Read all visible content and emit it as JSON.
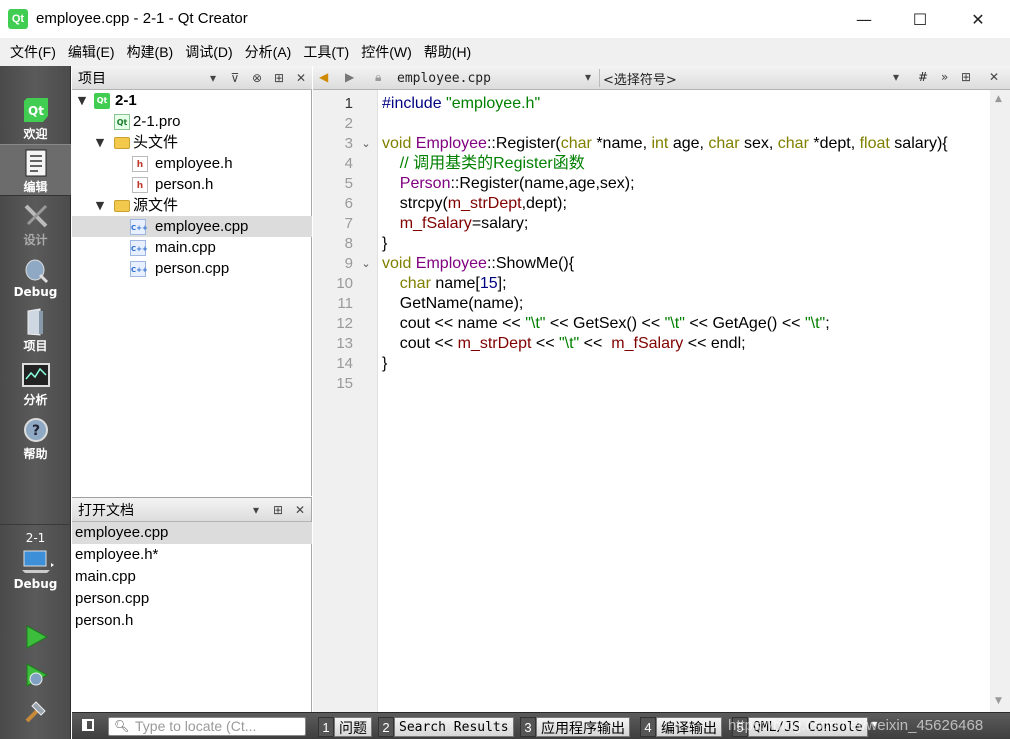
{
  "window": {
    "title": "employee.cpp - 2-1 - Qt Creator",
    "icon": "qt-icon",
    "minimize": "—",
    "maximize": "☐",
    "close": "✕"
  },
  "menu": [
    "文件(F)",
    "编辑(E)",
    "构建(B)",
    "调试(D)",
    "分析(A)",
    "工具(T)",
    "控件(W)",
    "帮助(H)"
  ],
  "modes": [
    {
      "label": "欢迎",
      "icon": "qt-welcome-icon"
    },
    {
      "label": "编辑",
      "icon": "edit-document-icon"
    },
    {
      "label": "设计",
      "icon": "design-tools-icon"
    },
    {
      "label": "Debug",
      "icon": "debug-bug-icon"
    },
    {
      "label": "项目",
      "icon": "project-folder-icon"
    },
    {
      "label": "分析",
      "icon": "analyze-monitor-icon"
    },
    {
      "label": "帮助",
      "icon": "help-icon"
    }
  ],
  "kit": {
    "project": "2-1",
    "mode": "Debug"
  },
  "run_buttons": [
    "run-icon",
    "debug-run-icon",
    "build-hammer-icon"
  ],
  "project_pane": {
    "title": "项目",
    "tree": [
      {
        "label": "2-1",
        "bold": true
      },
      {
        "label": "2-1.pro"
      },
      {
        "label": "头文件"
      },
      {
        "label": "employee.h"
      },
      {
        "label": "person.h"
      },
      {
        "label": "源文件"
      },
      {
        "label": "employee.cpp",
        "selected": true
      },
      {
        "label": "main.cpp"
      },
      {
        "label": "person.cpp"
      }
    ]
  },
  "open_docs": {
    "title": "打开文档",
    "items": [
      "employee.cpp",
      "employee.h*",
      "main.cpp",
      "person.cpp",
      "person.h"
    ]
  },
  "editor_toolbar": {
    "file": "employee.cpp",
    "symbol": "<选择符号>",
    "hash": "#"
  },
  "editor": {
    "line_numbers": [
      "1",
      "2",
      "3",
      "4",
      "5",
      "6",
      "7",
      "8",
      "9",
      "10",
      "11",
      "12",
      "13",
      "14",
      "15"
    ],
    "current_line": 1,
    "code": {
      "l1_directive": "#include ",
      "l1_header": "\"employee.h\"",
      "l3_void": "void ",
      "l3_class": "Employee",
      "l3_rest": "::Register(",
      "l3_char": "char",
      "l3_p1": " *name, ",
      "l3_int": "int",
      "l3_p2": " age, ",
      "l3_char2": "char",
      "l3_p3": " sex, ",
      "l3_char3": "char",
      "l3_p4": " *dept, ",
      "l3_float": "float",
      "l3_p5": " salary){",
      "l4_comment": "    // 调用基类的Register函数",
      "l5_indent": "    ",
      "l5_class": "Person",
      "l5_rest": "::Register(name,age,sex);",
      "l6_a": "    strcpy(",
      "l6_member": "m_strDept",
      "l6_b": ",dept);",
      "l7_indent": "    ",
      "l7_member": "m_fSalary",
      "l7_rest": "=salary;",
      "l8": "}",
      "l9_void": "void ",
      "l9_class": "Employee",
      "l9_rest": "::ShowMe(){",
      "l10_indent": "    ",
      "l10_char": "char",
      "l10_a": " name[",
      "l10_num": "15",
      "l10_b": "];",
      "l11": "    GetName(name);",
      "l12_a": "    cout << name << ",
      "l12_s1": "\"\\t\"",
      "l12_b": " << GetSex() << ",
      "l12_s2": "\"\\t\"",
      "l12_c": " << GetAge() << ",
      "l12_s3": "\"\\t\"",
      "l12_d": ";",
      "l13_a": "    cout << ",
      "l13_m1": "m_strDept",
      "l13_b": " << ",
      "l13_s1": "\"\\t\"",
      "l13_c": " <<  ",
      "l13_m2": "m_fSalary",
      "l13_d": " << endl;",
      "l14": "}"
    }
  },
  "statusbar": {
    "locator_placeholder": "Type to locate (Ct...",
    "tabs": [
      {
        "num": "1",
        "label": "问题"
      },
      {
        "num": "2",
        "label": "Search Results"
      },
      {
        "num": "3",
        "label": "应用程序输出"
      },
      {
        "num": "4",
        "label": "编译输出"
      },
      {
        "num": "5",
        "label": "QML/JS Console"
      }
    ],
    "watermark": "https://blog.csdn.net/weixin_45626468"
  }
}
